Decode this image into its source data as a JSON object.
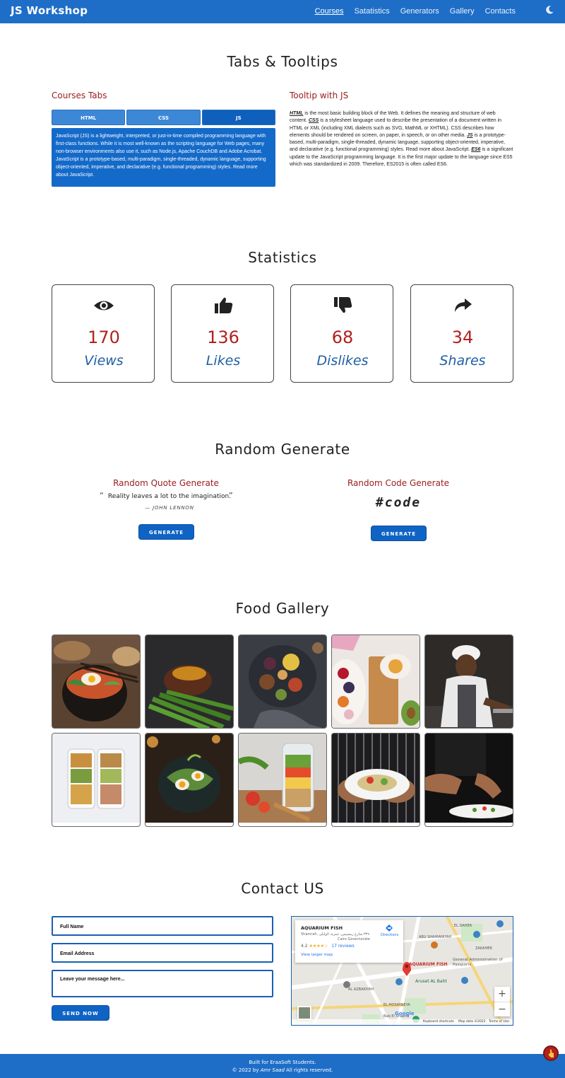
{
  "nav": {
    "brand": "JS Workshop",
    "links": [
      "Courses",
      "Satatistics",
      "Generators",
      "Gallery",
      "Contacts"
    ],
    "theme_icon": "moon-icon"
  },
  "tabs_section": {
    "title": "Tabs & Tooltips",
    "tabs_heading": "Courses Tabs",
    "tab_labels": [
      "HTML",
      "CSS",
      "JS"
    ],
    "active_tab": "JS",
    "panel_text": "JavaScript (JS) is a lightweight, interpreted, or just-in-time compiled programming language with first-class functions. While it is most well-known as the scripting language for Web pages, many non-browser environments also use it, such as Node.js, Apache CouchDB and Adobe Acrobat. JavaScript is a prototype-based, multi-paradigm, single-threaded, dynamic language, supporting object-oriented, imperative, and declarative (e.g. functional programming) styles. Read more about JavaScript.",
    "tooltip_heading": "Tooltip with JS",
    "tooltip_terms": [
      "HTML",
      "CSS",
      "JS",
      "ES6"
    ],
    "tooltip_parts": [
      " is the most basic building block of the Web. It defines the meaning and structure of web content. ",
      " is a stylesheet language used to describe the presentation of a document written in HTML or XML (including XML dialects such as SVG, MathML or XHTML). CSS describes how elements should be rendered on screen, on paper, in speech, or on other media. ",
      " is a prototype-based, multi-paradigm, single-threaded, dynamic language, supporting object-oriented, imperative, and declarative (e.g. functional programming) styles. Read more about JavaScript. ",
      " is a significant update to the JavaScript programming language. It is the first major update to the language since ES5 which was standardized in 2009. Therefore, ES2015 is often called ES6."
    ]
  },
  "stats": {
    "title": "Statistics",
    "cards": [
      {
        "icon": "eye-icon",
        "value": "170",
        "label": "Views"
      },
      {
        "icon": "thumbs-up-icon",
        "value": "136",
        "label": "Likes"
      },
      {
        "icon": "thumbs-down-icon",
        "value": "68",
        "label": "Dislikes"
      },
      {
        "icon": "share-icon",
        "value": "34",
        "label": "Shares"
      }
    ]
  },
  "random": {
    "title": "Random Generate",
    "quote_heading": "Random Quote Generate",
    "quote_open": "“",
    "quote_text": "Reality leaves a lot to the imagination.",
    "quote_close": "”",
    "quote_author": "— JOHN LENNON",
    "code_heading": "Random Code Generate",
    "code_text": "#code",
    "button_label": "GENERATE"
  },
  "gallery": {
    "title": "Food Gallery",
    "items": [
      "bibimbap-bowl",
      "steak-green-beans",
      "grazing-platter",
      "fruit-board",
      "chef-cooking",
      "meal-prep-boxes",
      "avocado-egg-salad",
      "salad-jar",
      "plated-salad",
      "chef-plating"
    ]
  },
  "contact": {
    "title": "Contact US",
    "fields": {
      "name_placeholder": "Full Name",
      "email_placeholder": "Email Address",
      "message_placeholder": "Leave your message here..."
    },
    "send_label": "SEND NOW",
    "map": {
      "place_name": "AQUARIUM FISH",
      "place_address": "Shamrah, ٣٣٩ شارع رمسيس، غمرة، الوايلي",
      "place_region": "Cairo Governorate",
      "rating": "4.2",
      "stars": "★★★★☆",
      "reviews": "17 reviews",
      "directions": "Directions",
      "larger_map": "View larger map",
      "marker_label": "AQUARIUM FISH",
      "labels": [
        "EL DAHER",
        "ABU SHAHIANIYAH",
        "ZAKAHER",
        "Aruset AL Baht",
        "AL AZBAKIYAH",
        "EL-HOSAYNEYA",
        "General Administration of Passports",
        "Bab El Shaeria"
      ],
      "zoom_in": "+",
      "zoom_out": "−",
      "footer_keyboard": "Keyboard shortcuts",
      "footer_data": "Map data ©2022",
      "footer_terms": "Terms of Use",
      "google": "Google"
    }
  },
  "footer": {
    "line1": "Built for EraaSoft Students.",
    "line2_prefix": "© 2022 by ",
    "author": "Amr Saad",
    "line2_suffix": " All rights reserved."
  },
  "colors": {
    "primary": "#1e6ec8",
    "accent_red": "#9a1c1c",
    "stat_number": "#b0221f",
    "stat_label": "#1f5fa5"
  }
}
